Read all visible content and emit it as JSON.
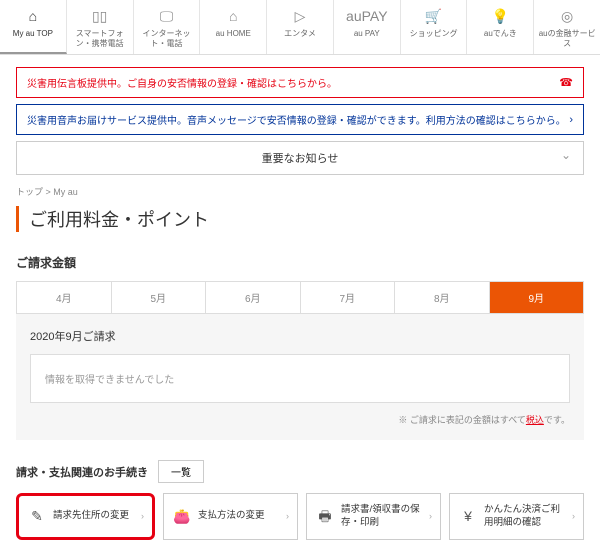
{
  "topnav": [
    {
      "label": "My au TOP",
      "icon": "⌂",
      "active": true,
      "name": "nav-myau-top"
    },
    {
      "label": "スマートフォン・携帯電話",
      "icon": "▯▯",
      "name": "nav-smartphone"
    },
    {
      "label": "インターネット・電話",
      "icon": "🖵",
      "name": "nav-internet"
    },
    {
      "label": "au HOME",
      "icon": "⌂",
      "name": "nav-auhome"
    },
    {
      "label": "エンタメ",
      "icon": "▷",
      "name": "nav-entertainment"
    },
    {
      "label": "au PAY",
      "icon": "auPAY",
      "name": "nav-aupay"
    },
    {
      "label": "ショッピング",
      "icon": "🛒",
      "name": "nav-shopping"
    },
    {
      "label": "auでんき",
      "icon": "💡",
      "name": "nav-audenki"
    },
    {
      "label": "auの金融サービス",
      "icon": "◎",
      "name": "nav-finance"
    }
  ],
  "alerts": {
    "red": "災害用伝言板提供中。ご自身の安否情報の登録・確認はこちらから。",
    "blue": "災害用音声お届けサービス提供中。音声メッセージで安否情報の登録・確認ができます。利用方法の確認はこちらから。"
  },
  "notice": "重要なお知らせ",
  "breadcrumb": "トップ > My au",
  "page_title": "ご利用料金・ポイント",
  "billing": {
    "heading": "ご請求金額",
    "months": [
      "4月",
      "5月",
      "6月",
      "7月",
      "8月",
      "9月"
    ],
    "active_month_index": 5,
    "box_title": "2020年9月ご請求",
    "msg": "情報を取得できませんでした",
    "note_prefix": "※ ご請求に表記の金額はすべて",
    "note_link": "税込",
    "note_suffix": "です。"
  },
  "procedures": {
    "heading": "請求・支払関連のお手続き",
    "list_btn": "一覧",
    "items": [
      {
        "label": "請求先住所の変更",
        "icon": "✎",
        "hl": true,
        "name": "proc-change-billing-address"
      },
      {
        "label": "支払方法の変更",
        "icon": "👛",
        "name": "proc-change-payment-method"
      },
      {
        "label": "請求書/領収書の保存・印刷",
        "icon": "🖶",
        "name": "proc-save-print-invoice"
      },
      {
        "label": "かんたん決済ご利用明細の確認",
        "icon": "¥",
        "name": "proc-easy-payment-details"
      }
    ]
  }
}
